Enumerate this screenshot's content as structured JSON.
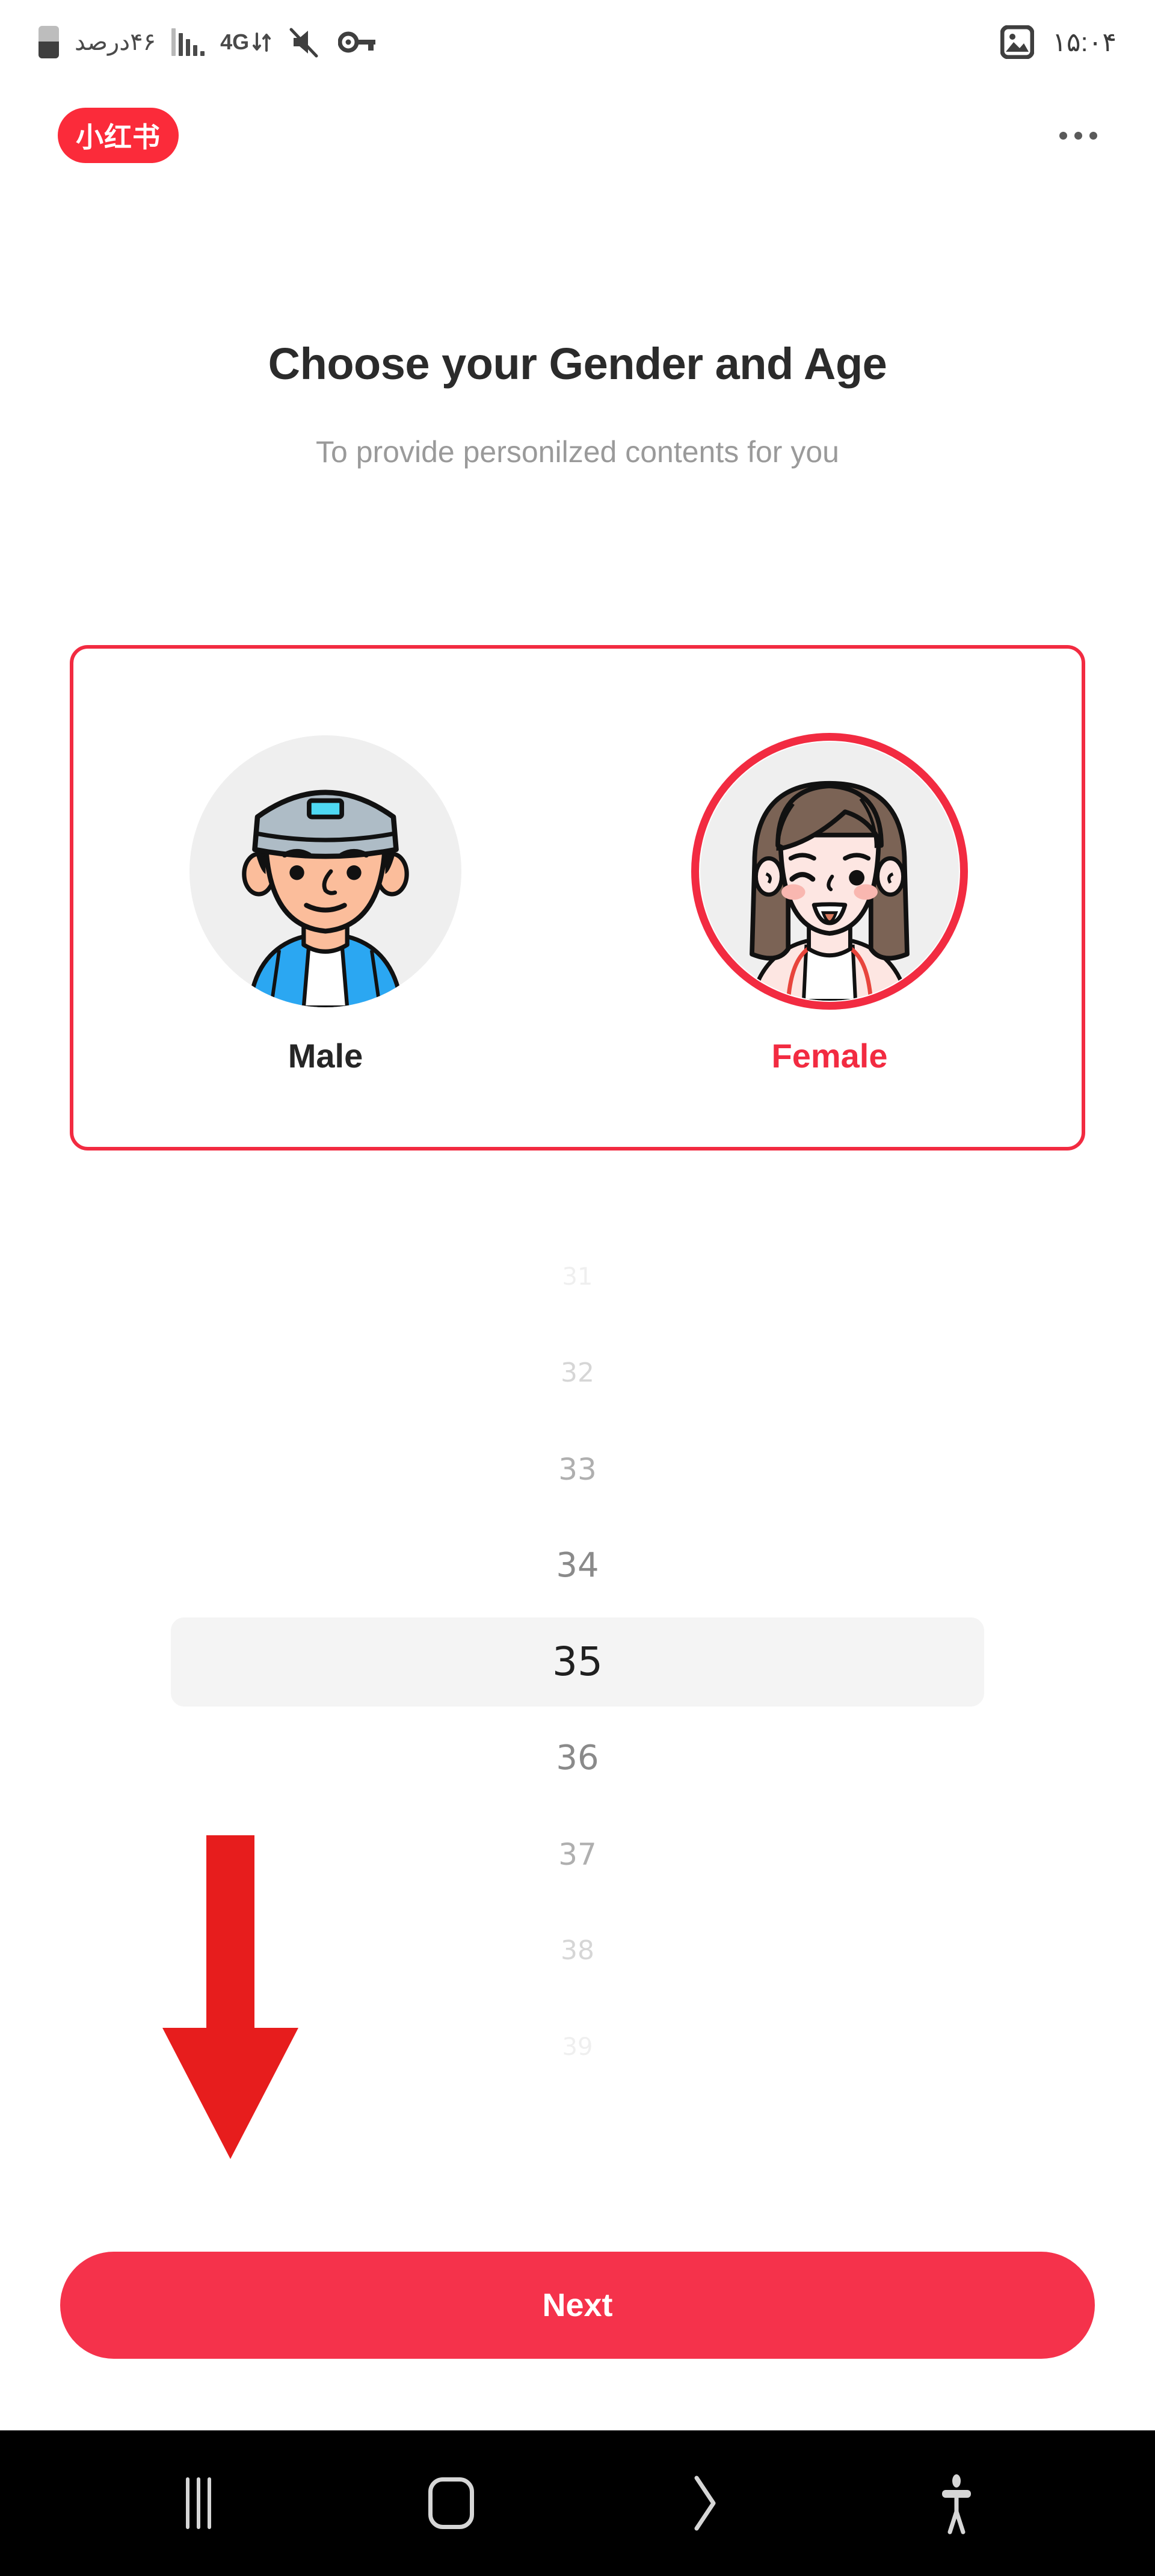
{
  "status_bar": {
    "battery_icon": "battery-icon",
    "battery_text": "۴۶درصد",
    "signal_icon": "signal-bars-icon",
    "network_label": "4G",
    "network_arrows_icon": "data-transfer-arrows-icon",
    "mute_icon": "volume-muted-icon",
    "vpn_icon": "vpn-key-icon",
    "gallery_icon": "image-screenshot-icon",
    "time": "۱۵:۰۴"
  },
  "header": {
    "brand": "小红书",
    "more_icon": "more-options-icon"
  },
  "main": {
    "title": "Choose your Gender and Age",
    "subtitle": "To provide personilzed contents for you"
  },
  "gender": {
    "options": [
      {
        "id": "male",
        "label": "Male",
        "avatar_icon": "male-avatar-icon",
        "selected": false
      },
      {
        "id": "female",
        "label": "Female",
        "avatar_icon": "female-avatar-icon",
        "selected": true
      }
    ],
    "selected_value": "Female",
    "selected_color": "#F22B41"
  },
  "age_picker": {
    "selected_value": "35",
    "visible_items": [
      {
        "value": "31",
        "opacity": 0.1,
        "size": 40
      },
      {
        "value": "32",
        "opacity": 0.28,
        "size": 44
      },
      {
        "value": "33",
        "opacity": 0.55,
        "size": 50
      },
      {
        "value": "34",
        "opacity": 0.8,
        "size": 56
      },
      {
        "value": "35",
        "opacity": 1.0,
        "size": 66
      },
      {
        "value": "36",
        "opacity": 0.8,
        "size": 56
      },
      {
        "value": "37",
        "opacity": 0.55,
        "size": 50
      },
      {
        "value": "38",
        "opacity": 0.28,
        "size": 44
      },
      {
        "value": "39",
        "opacity": 0.1,
        "size": 40
      }
    ]
  },
  "annotation": {
    "arrow_icon": "down-arrow-annotation-icon",
    "arrow_color": "#E71D1D"
  },
  "footer": {
    "next_label": "Next",
    "next_color": "#F5324B"
  },
  "nav_bar": {
    "recents_icon": "recent-apps-icon",
    "home_icon": "home-icon",
    "back_icon": "back-chevron-icon",
    "accessibility_icon": "accessibility-icon"
  }
}
